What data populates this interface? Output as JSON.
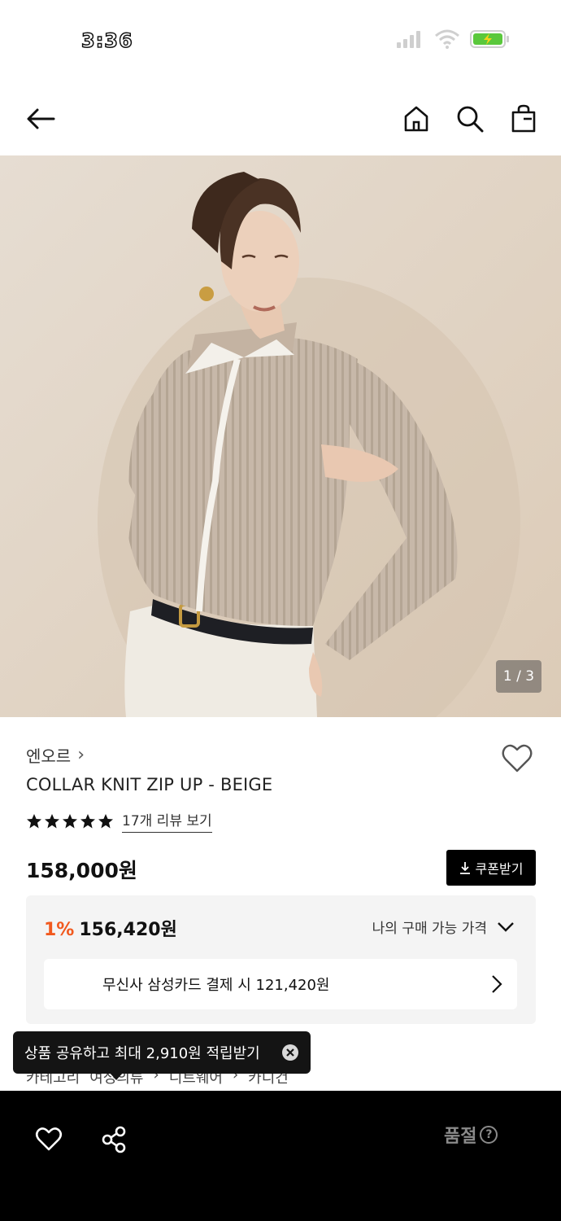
{
  "status_bar": {
    "time": "3:36"
  },
  "product": {
    "image_counter": "1 / 3",
    "brand": "엔오르",
    "brand_chevron": "›",
    "name": "COLLAR KNIT ZIP UP - BEIGE",
    "rating_stars": 5,
    "review_link": "17개 리뷰 보기",
    "price": "158,000원",
    "coupon_button": "쿠폰받기"
  },
  "price_box": {
    "discount_rate": "1%",
    "discount_price": "156,420원",
    "my_price_label": "나의 구매 가능 가격",
    "card_offer": "무신사 삼성카드 결제 시 121,420원"
  },
  "breadcrumb": [
    "카테고리",
    "여성의류",
    "니트웨어",
    "카디건"
  ],
  "toast": {
    "text": "상품 공유하고 최대 2,910원 적립받기"
  },
  "bottom_bar": {
    "soldout_label": "품절",
    "help_glyph": "?"
  },
  "icons": {
    "back": "arrow-left-icon",
    "home": "home-icon",
    "search": "search-icon",
    "bag": "shopping-bag-icon",
    "wishlist": "heart-icon",
    "share": "share-icon",
    "close": "close-icon"
  },
  "colors": {
    "accent_discount": "#f1591e",
    "bottom_bar": "#000000",
    "soldout_text": "#8a8a8a"
  }
}
